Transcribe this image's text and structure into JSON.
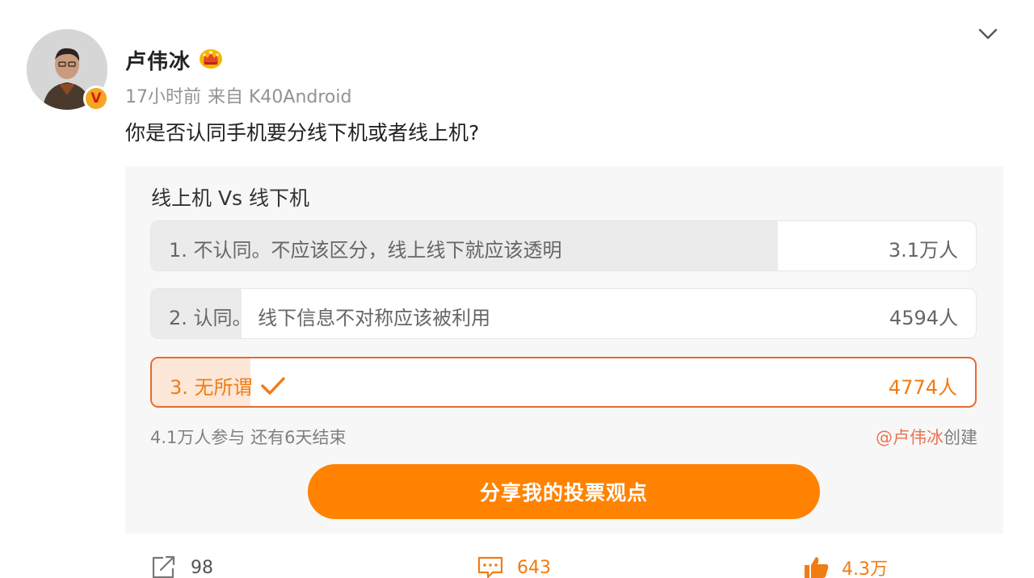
{
  "user": {
    "name": "卢伟冰",
    "time": "17小时前",
    "source": "来自 K40Android",
    "verified_badge": "V"
  },
  "post": {
    "text": "你是否认同手机要分线下机或者线上机?"
  },
  "poll": {
    "title": "线上机 Vs 线下机",
    "options": [
      {
        "label": "1. 不认同。不应该区分，线上线下就应该透明",
        "count": "3.1万人",
        "share": 0.76,
        "selected": false
      },
      {
        "label": "2. 认同。 线下信息不对称应该被利用",
        "count": "4594人",
        "share": 0.11,
        "selected": false
      },
      {
        "label": "3. 无所谓",
        "count": "4774人",
        "share": 0.12,
        "selected": true
      }
    ],
    "participants": "4.1万人参与",
    "remaining": "还有6天结束",
    "creator_mention": "@卢伟冰",
    "creator_suffix": "创建",
    "share_button": "分享我的投票观点"
  },
  "actions": {
    "repost": "98",
    "comment": "643",
    "like": "4.3万"
  },
  "colors": {
    "accent": "#ff8200",
    "selected_border": "#e86a2e",
    "mention": "#eb7350"
  },
  "icons": [
    "avatar",
    "verified-badge",
    "crown-icon",
    "chevron-down-icon",
    "checkmark-icon",
    "repost-icon",
    "comment-icon",
    "like-icon"
  ]
}
